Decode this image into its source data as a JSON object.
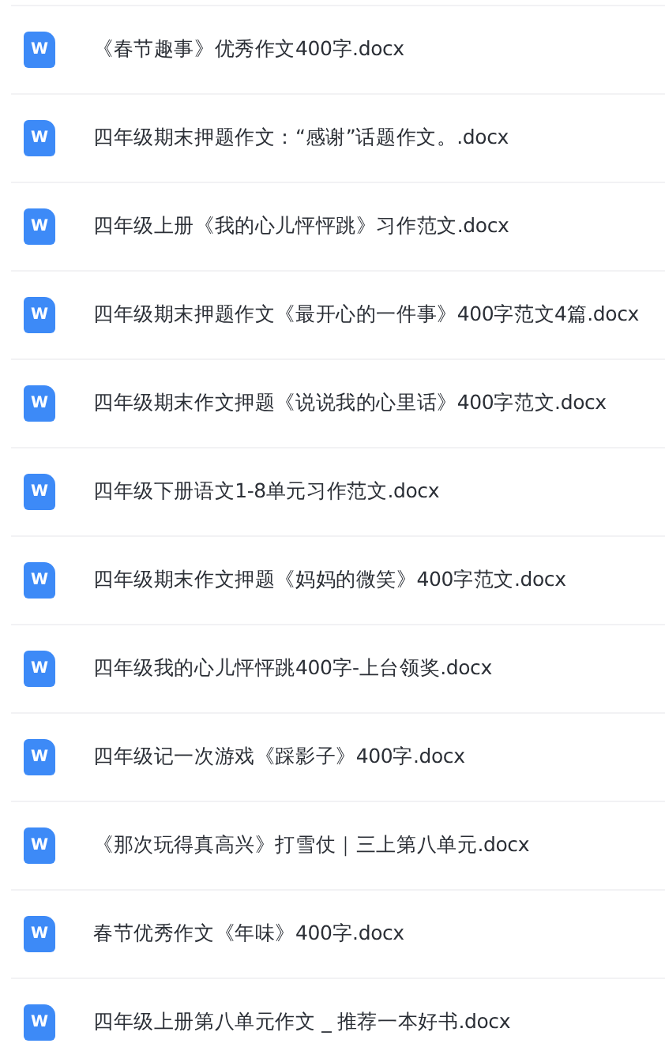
{
  "files": [
    {
      "icon_label": "W",
      "name": "《春节趣事》优秀作文400字.docx"
    },
    {
      "icon_label": "W",
      "name": "四年级期末押题作文：“感谢”话题作文。.docx"
    },
    {
      "icon_label": "W",
      "name": "四年级上册《我的心儿怦怦跳》习作范文.docx"
    },
    {
      "icon_label": "W",
      "name": "四年级期末押题作文《最开心的一件事》400字范文4篇.docx"
    },
    {
      "icon_label": "W",
      "name": "四年级期末作文押题《说说我的心里话》400字范文.docx"
    },
    {
      "icon_label": "W",
      "name": "四年级下册语文1-8单元习作范文.docx"
    },
    {
      "icon_label": "W",
      "name": "四年级期末作文押题《妈妈的微笑》400字范文.docx"
    },
    {
      "icon_label": "W",
      "name": "四年级我的心儿怦怦跳400字-上台领奖.docx"
    },
    {
      "icon_label": "W",
      "name": "四年级记一次游戏《踩影子》400字.docx"
    },
    {
      "icon_label": "W",
      "name": "《那次玩得真高兴》打雪仗｜三上第八单元.docx"
    },
    {
      "icon_label": "W",
      "name": "春节优秀作文《年味》400字.docx"
    },
    {
      "icon_label": "W",
      "name": "四年级上册第八单元作文 _ 推荐一本好书.docx"
    }
  ]
}
